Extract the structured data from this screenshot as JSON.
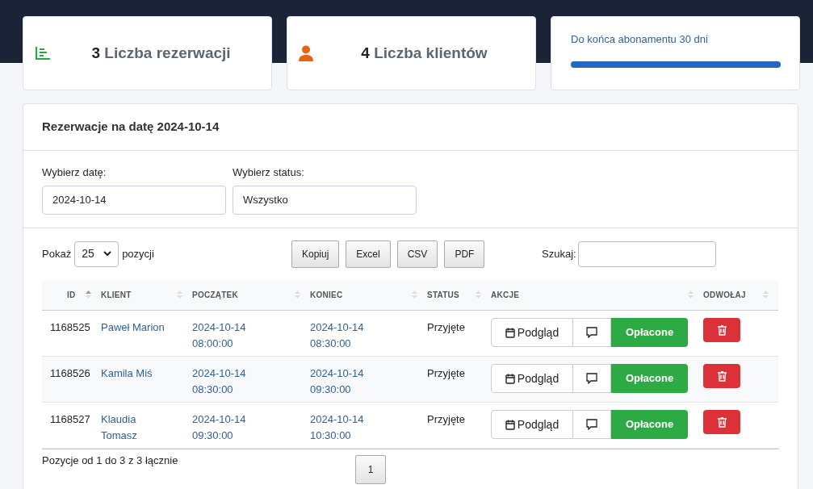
{
  "stats": [
    {
      "kind": "chart",
      "value": "3",
      "label": "Liczba rezerwacji"
    },
    {
      "kind": "person",
      "value": "4",
      "label": "Liczba klientów"
    }
  ],
  "subscription": {
    "text": "Do końca abonamentu 30 dni",
    "level": 1
  },
  "panel": {
    "title": "Rezerwacje na datę 2024-10-14",
    "filters": [
      {
        "label": "Wybierz datę:",
        "value": "2024-10-14"
      },
      {
        "label": "Wybierz status:",
        "value": "Wszystko"
      }
    ],
    "show": {
      "before": "Pokaż",
      "value": "25",
      "after": "pozycji"
    },
    "export_buttons": [
      "Kopiuj",
      "Excel",
      "CSV",
      "PDF"
    ],
    "search": {
      "label": "Szukaj:"
    },
    "table": {
      "columns": [
        {
          "label": "ID",
          "sorted": true
        },
        {
          "label": "KLIENT",
          "sorted": false
        },
        {
          "label": "POCZĄTEK",
          "sorted": false
        },
        {
          "label": "KONIEC",
          "sorted": false
        },
        {
          "label": "STATUS",
          "sorted": false
        },
        {
          "label": "AKCJE",
          "sorted": false
        },
        {
          "label": "ODWOŁAJ",
          "sorted": false
        }
      ],
      "rows": [
        {
          "id": "1168525",
          "client": "Paweł Marion",
          "start": [
            "2024-10-14",
            "08:00:00"
          ],
          "end": [
            "2024-10-14",
            "08:30:00"
          ],
          "status": "Przyjęte",
          "preview": "Podgląd",
          "paid": "Opłacone"
        },
        {
          "id": "1168526",
          "client": "Kamila Miś",
          "start": [
            "2024-10-14",
            "08:30:00"
          ],
          "end": [
            "2024-10-14",
            "09:30:00"
          ],
          "status": "Przyjęte",
          "preview": "Podgląd",
          "paid": "Opłacone"
        },
        {
          "id": "1168527",
          "client": "Klaudia Tomasz",
          "start": [
            "2024-10-14",
            "09:30:00"
          ],
          "end": [
            "2024-10-14",
            "10:30:00"
          ],
          "status": "Przyjęte",
          "preview": "Podgląd",
          "paid": "Opłacone"
        }
      ]
    },
    "info": "Pozycje od 1 do 3 z 3 łącznie",
    "pages": [
      {
        "label": "1",
        "selected": true
      }
    ]
  }
}
